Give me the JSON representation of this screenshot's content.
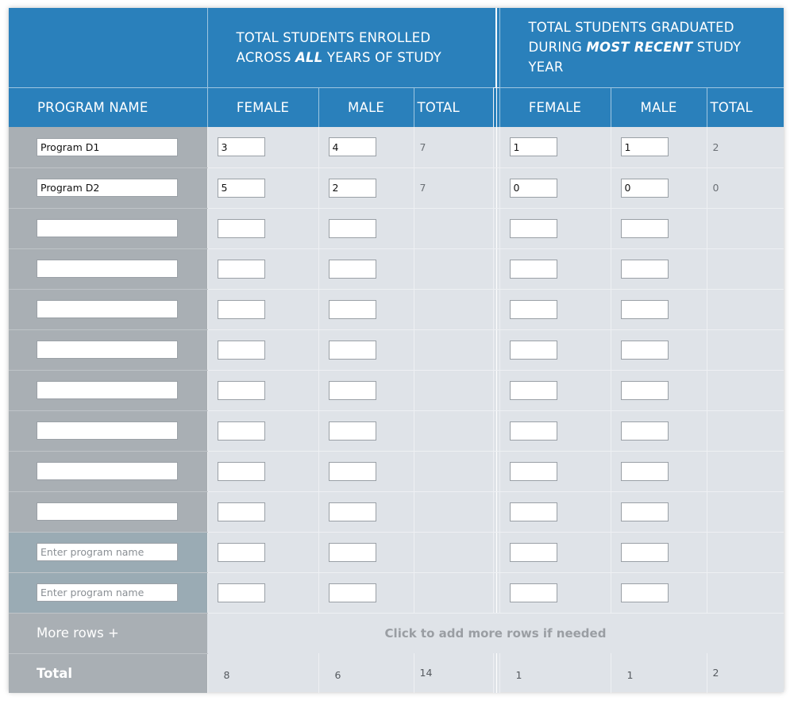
{
  "header": {
    "enrolled_line1": "TOTAL STUDENTS ENROLLED",
    "enrolled_line2_pre": "ACROSS ",
    "enrolled_line2_em": "ALL",
    "enrolled_line2_post": " YEARS OF STUDY",
    "graduated_line1": "TOTAL STUDENTS GRADUATED",
    "graduated_line2_pre": "DURING ",
    "graduated_line2_em": "MOST RECENT",
    "graduated_line2_post": " STUDY",
    "graduated_line3": "YEAR",
    "program_name": "PROGRAM NAME",
    "female": "FEMALE",
    "male": "MALE",
    "total": "TOTAL"
  },
  "placeholder": "Enter program name",
  "rows": [
    {
      "name": "Program D1",
      "enr_f": "3",
      "enr_m": "4",
      "enr_t": "7",
      "grad_f": "1",
      "grad_m": "1",
      "grad_t": "2"
    },
    {
      "name": "Program D2",
      "enr_f": "5",
      "enr_m": "2",
      "enr_t": "7",
      "grad_f": "0",
      "grad_m": "0",
      "grad_t": "0"
    },
    {
      "name": "",
      "enr_f": "",
      "enr_m": "",
      "enr_t": "",
      "grad_f": "",
      "grad_m": "",
      "grad_t": ""
    },
    {
      "name": "",
      "enr_f": "",
      "enr_m": "",
      "enr_t": "",
      "grad_f": "",
      "grad_m": "",
      "grad_t": ""
    },
    {
      "name": "",
      "enr_f": "",
      "enr_m": "",
      "enr_t": "",
      "grad_f": "",
      "grad_m": "",
      "grad_t": ""
    },
    {
      "name": "",
      "enr_f": "",
      "enr_m": "",
      "enr_t": "",
      "grad_f": "",
      "grad_m": "",
      "grad_t": ""
    },
    {
      "name": "",
      "enr_f": "",
      "enr_m": "",
      "enr_t": "",
      "grad_f": "",
      "grad_m": "",
      "grad_t": ""
    },
    {
      "name": "",
      "enr_f": "",
      "enr_m": "",
      "enr_t": "",
      "grad_f": "",
      "grad_m": "",
      "grad_t": ""
    },
    {
      "name": "",
      "enr_f": "",
      "enr_m": "",
      "enr_t": "",
      "grad_f": "",
      "grad_m": "",
      "grad_t": ""
    },
    {
      "name": "",
      "enr_f": "",
      "enr_m": "",
      "enr_t": "",
      "grad_f": "",
      "grad_m": "",
      "grad_t": ""
    },
    {
      "name": "",
      "placeholder": true,
      "enr_f": "",
      "enr_m": "",
      "enr_t": "",
      "grad_f": "",
      "grad_m": "",
      "grad_t": ""
    },
    {
      "name": "",
      "placeholder": true,
      "enr_f": "",
      "enr_m": "",
      "enr_t": "",
      "grad_f": "",
      "grad_m": "",
      "grad_t": ""
    }
  ],
  "more_rows": {
    "label": "More rows +",
    "hint": "Click to add more rows if needed"
  },
  "totals": {
    "label": "Total",
    "enr_f": "8",
    "enr_m": "6",
    "enr_t": "14",
    "grad_f": "1",
    "grad_m": "1",
    "grad_t": "2"
  },
  "colors": {
    "header": "#2a80bb",
    "name_column": "#a9afb4",
    "body": "#dfe3e8"
  }
}
